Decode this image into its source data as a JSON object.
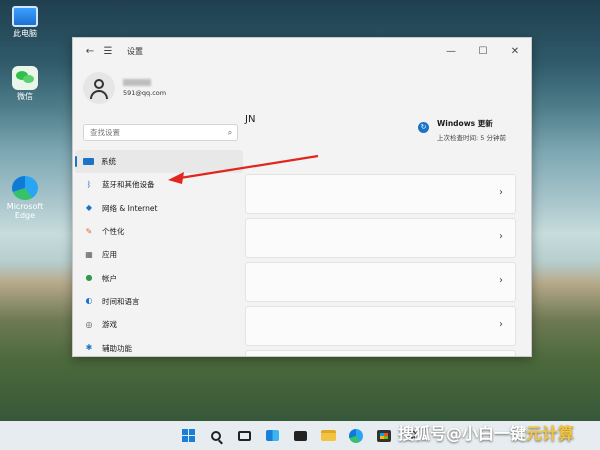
{
  "desktop": {
    "icons": [
      {
        "label": "此电脑",
        "icon": "computer-icon"
      },
      {
        "label": "微信",
        "icon": "wechat-icon"
      },
      {
        "label": "Microsoft Edge",
        "icon": "edge-icon"
      }
    ]
  },
  "window": {
    "title": "设置",
    "back_icon": "back-arrow-icon",
    "menu_icon": "hamburger-icon",
    "controls": {
      "minimize": "—",
      "maximize": "☐",
      "close": "✕"
    }
  },
  "profile": {
    "email": "591@qq.com"
  },
  "search": {
    "placeholder": "查找设置",
    "icon": "search-icon"
  },
  "nav": {
    "items": [
      {
        "label": "系统",
        "icon": "display-icon",
        "color": "#1a73c7",
        "active": true
      },
      {
        "label": "蓝牙和其他设备",
        "icon": "bluetooth-icon",
        "color": "#1a73c7"
      },
      {
        "label": "网络 & Internet",
        "icon": "wifi-icon",
        "color": "#1a73c7"
      },
      {
        "label": "个性化",
        "icon": "brush-icon",
        "color": "#d9682a"
      },
      {
        "label": "应用",
        "icon": "apps-icon",
        "color": "#555555"
      },
      {
        "label": "帐户",
        "icon": "person-icon",
        "color": "#2e9b4c"
      },
      {
        "label": "时间和语言",
        "icon": "globe-clock-icon",
        "color": "#1a73c7"
      },
      {
        "label": "游戏",
        "icon": "gamepad-icon",
        "color": "#555555"
      },
      {
        "label": "辅助功能",
        "icon": "accessibility-icon",
        "color": "#1a73c7"
      }
    ]
  },
  "main": {
    "heading": "JN",
    "update": {
      "title": "Windows 更新",
      "subtitle": "上次检查时间: 5 分钟前",
      "icon": "refresh-icon"
    },
    "cards": [
      {
        "chevron": "›"
      },
      {
        "chevron": "›"
      },
      {
        "chevron": "›"
      },
      {
        "chevron": "›"
      },
      {
        "chevron": "›"
      }
    ]
  },
  "taskbar": {
    "items": [
      "start-icon",
      "search-icon",
      "task-view-icon",
      "widgets-icon",
      "chat-icon",
      "file-explorer-icon",
      "edge-icon",
      "store-icon",
      "settings-icon"
    ]
  },
  "watermark": {
    "prefix": "搜狐号@小白一键",
    "suffix": "元计算"
  },
  "annotation": {
    "arrow_color": "#e0261f"
  }
}
